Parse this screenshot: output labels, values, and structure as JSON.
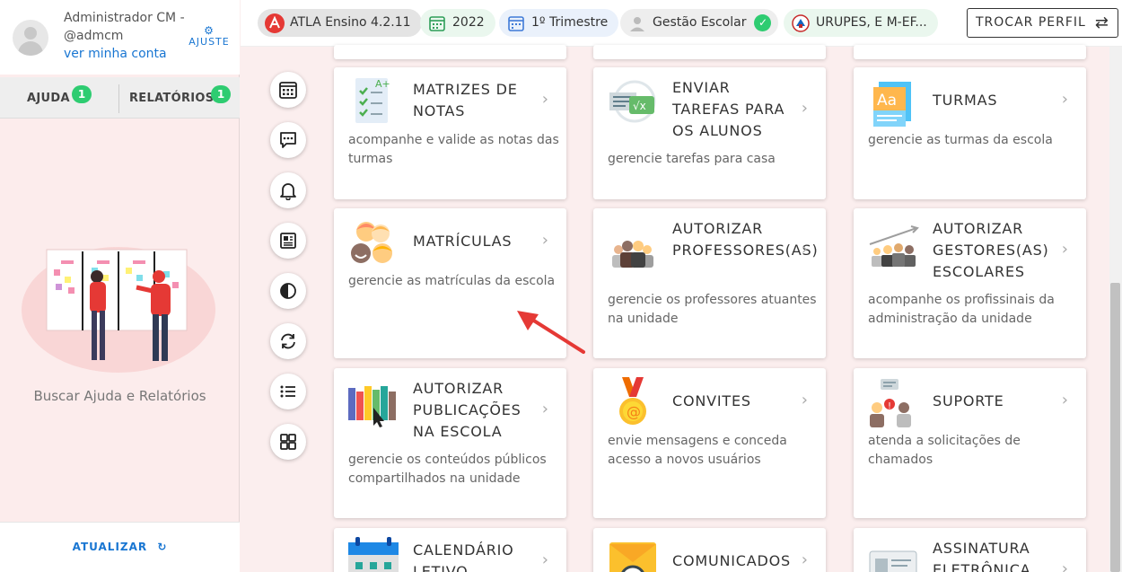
{
  "user": {
    "name": "Administrador CM - @admcm",
    "link": "ver minha conta",
    "ajuste": "AJUSTE"
  },
  "sidebar": {
    "tabs": [
      {
        "label": "AJUDA",
        "badge": "1"
      },
      {
        "label": "RELATÓRIOS",
        "badge": "1"
      }
    ],
    "help_text": "Buscar Ajuda e Relatórios",
    "refresh_label": "ATUALIZAR"
  },
  "topbar": {
    "pills": [
      "ATLA Ensino 4.2.11",
      "2022",
      "1º Trimestre",
      "Gestão Escolar",
      "URUPES, E M-EF..."
    ],
    "switch_label": "TROCAR PERFIL"
  },
  "colors": {
    "accent": "#1976d2",
    "badge": "#2ecc71",
    "brand_red": "#e53935"
  },
  "cards": [
    {
      "title": "MATRIZES DE NOTAS",
      "desc": "acompanhe e valide as notas das turmas"
    },
    {
      "title": "ENVIAR TAREFAS PARA OS ALUNOS",
      "desc": "gerencie tarefas para casa"
    },
    {
      "title": "TURMAS",
      "desc": "gerencie as turmas da escola"
    },
    {
      "title": "MATRÍCULAS",
      "desc": "gerencie as matrículas da escola"
    },
    {
      "title": "AUTORIZAR PROFESSORES(AS)",
      "desc": "gerencie os professores atuantes na unidade"
    },
    {
      "title": "AUTORIZAR GESTORES(AS) ESCOLARES",
      "desc": "acompanhe os profissinais da administração da unidade"
    },
    {
      "title": "AUTORIZAR PUBLICAÇÕES NA ESCOLA",
      "desc": "gerencie os conteúdos públicos compartilhados na unidade"
    },
    {
      "title": "CONVITES",
      "desc": "envie mensagens e conceda acesso a novos usuários"
    },
    {
      "title": "SUPORTE",
      "desc": "atenda a solicitações de chamados"
    },
    {
      "title": "CALENDÁRIO LETIVO",
      "desc": ""
    },
    {
      "title": "COMUNICADOS",
      "desc": ""
    },
    {
      "title": "ASSINATURA ELETRÔNICA",
      "desc": ""
    }
  ]
}
